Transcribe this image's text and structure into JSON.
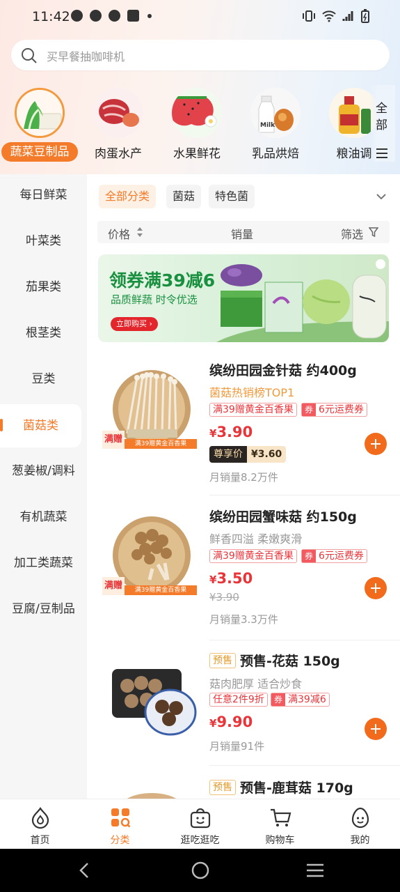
{
  "status": {
    "time": "11:42"
  },
  "search": {
    "placeholder": "买早餐抽咖啡机"
  },
  "top_categories": [
    {
      "label": "蔬菜豆制品",
      "active": true
    },
    {
      "label": "肉蛋水产",
      "active": false
    },
    {
      "label": "水果鲜花",
      "active": false
    },
    {
      "label": "乳品烘焙",
      "active": false
    },
    {
      "label": "粮油调",
      "active": false
    }
  ],
  "all_categories": "全部",
  "left_nav": [
    {
      "label": "每日鲜菜"
    },
    {
      "label": "叶菜类"
    },
    {
      "label": "茄果类"
    },
    {
      "label": "根茎类"
    },
    {
      "label": "豆类"
    },
    {
      "label": "菌菇类",
      "active": true
    },
    {
      "label": "葱姜椒/调料"
    },
    {
      "label": "有机蔬菜"
    },
    {
      "label": "加工类蔬菜"
    },
    {
      "label": "豆腐/豆制品"
    }
  ],
  "filter_chips": [
    {
      "label": "全部分类",
      "active": true
    },
    {
      "label": "菌菇"
    },
    {
      "label": "特色菌"
    }
  ],
  "sort": {
    "price": "价格",
    "sales": "销量",
    "filter": "筛选"
  },
  "banner": {
    "title": "领券满39减6",
    "subtitle": "品质鲜蔬 时令优选",
    "button": "立即购买"
  },
  "products": [
    {
      "name": "缤纷田园金针菇 约400g",
      "subtitle": "菌菇热销榜TOP1",
      "tag1": "满39赠黄金百香果",
      "coupon_icon": "券",
      "coupon": "6元运费券",
      "price_symbol": "¥",
      "price": "3.90",
      "member_label": "尊享价",
      "member_price": "¥3.60",
      "sales": "月销量8.2万件",
      "badge_left": "满赠",
      "badge_right": "满39赠黄金百香果"
    },
    {
      "name": "缤纷田园蟹味菇 约150g",
      "subtitle": "鲜香四溢 柔嫩爽滑",
      "tag1": "满39赠黄金百香果",
      "coupon_icon": "券",
      "coupon": "6元运费券",
      "price_symbol": "¥",
      "price": "3.50",
      "old_price": "¥3.90",
      "sales": "月销量3.3万件",
      "badge_left": "满赠",
      "badge_right": "满39赠黄金百香果"
    },
    {
      "presale": "预售",
      "name": "预售-花菇 150g",
      "subtitle": "菇肉肥厚 适合炒食",
      "tag1": "任意2件9折",
      "coupon_icon": "券",
      "coupon": "满39减6",
      "price_symbol": "¥",
      "price": "9.90",
      "sales": "月销量91件"
    },
    {
      "presale": "预售",
      "name": "预售-鹿茸菇 170g"
    }
  ],
  "bottom_nav": [
    {
      "label": "首页",
      "icon": "home-icon"
    },
    {
      "label": "分类",
      "icon": "category-icon",
      "active": true
    },
    {
      "label": "逛吃逛吃",
      "icon": "bag-face-icon"
    },
    {
      "label": "购物车",
      "icon": "cart-icon"
    },
    {
      "label": "我的",
      "icon": "egg-face-icon"
    }
  ],
  "colors": {
    "accent": "#f47b2a",
    "price": "#e8353a",
    "green": "#19903f"
  }
}
